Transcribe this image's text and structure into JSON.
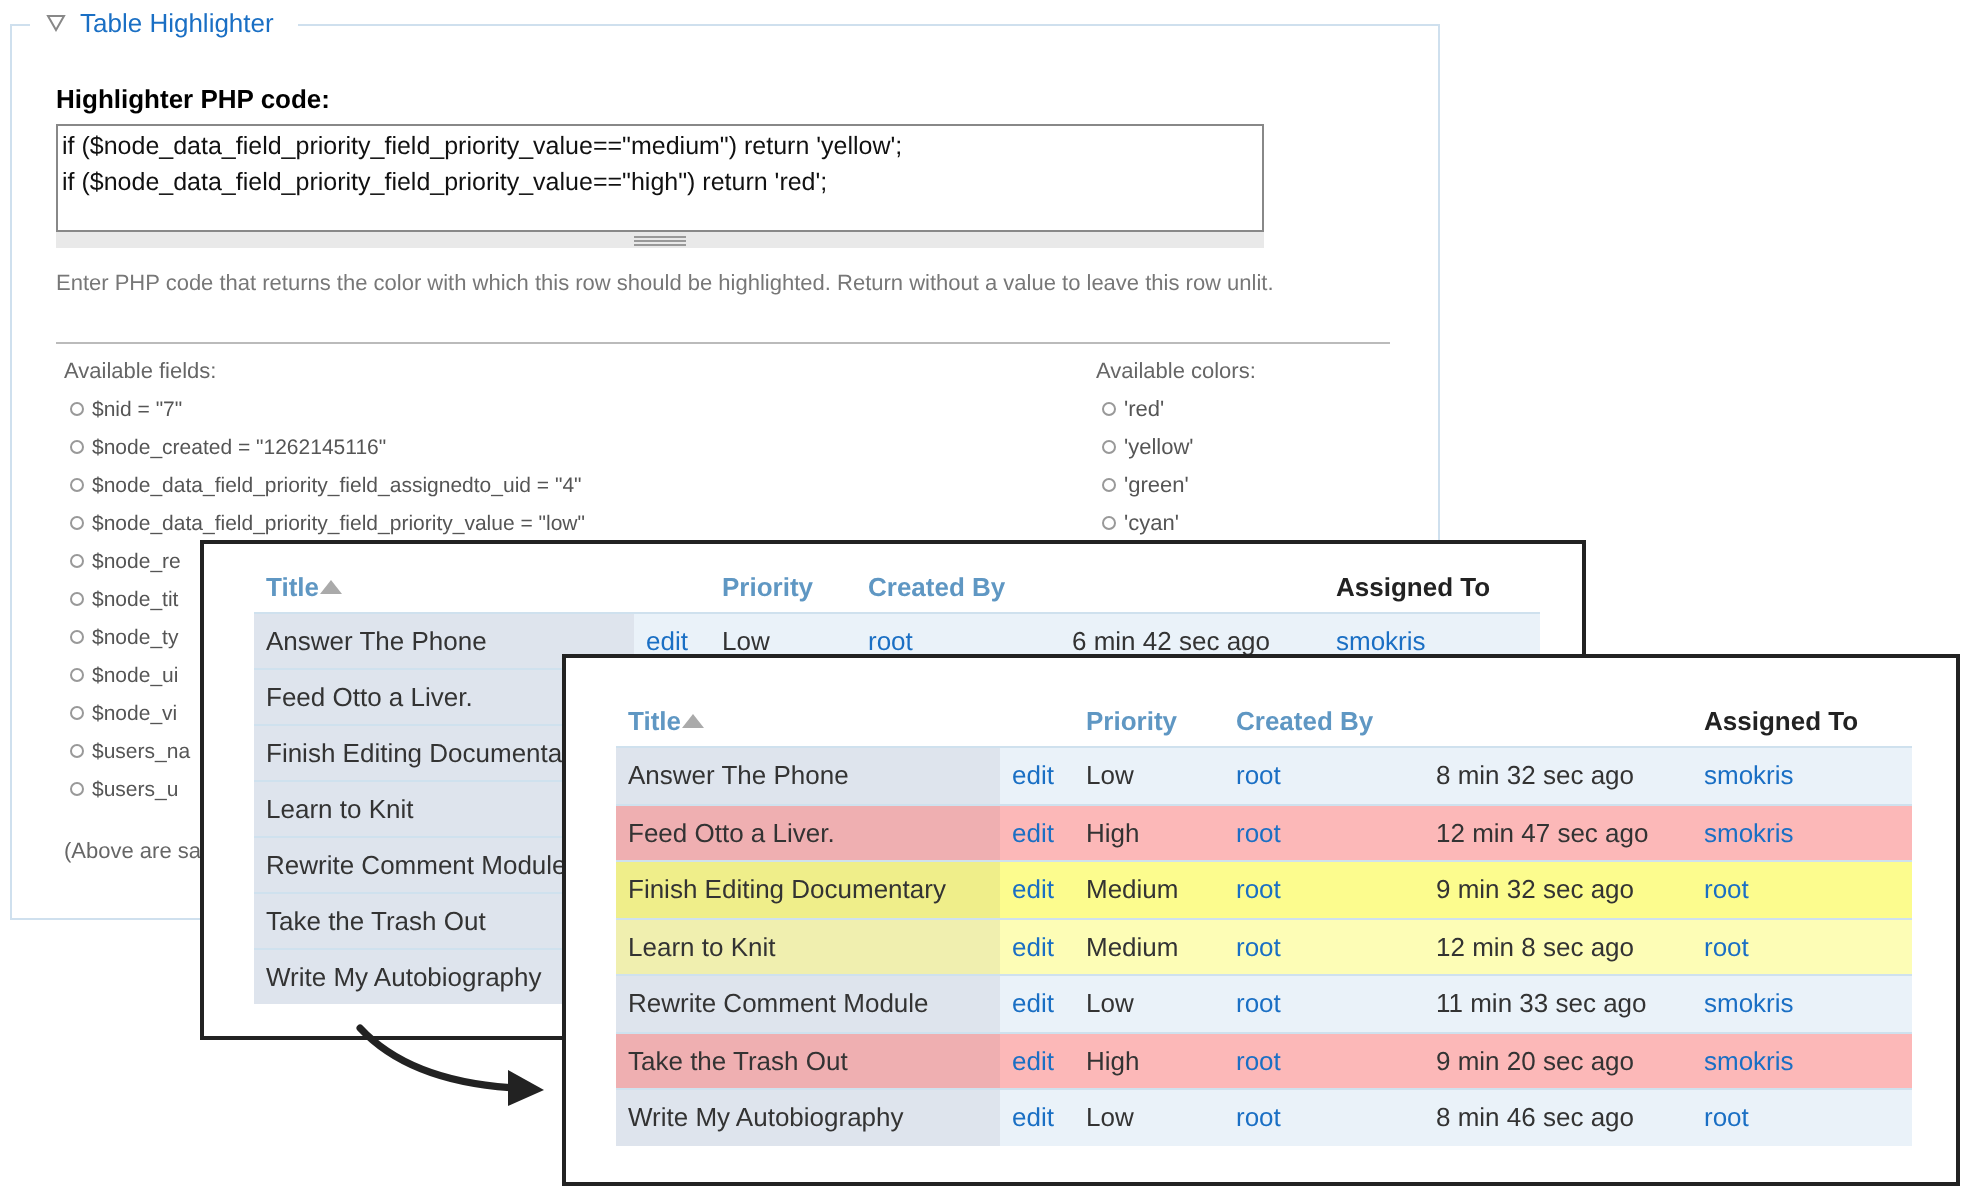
{
  "fieldset": {
    "legend": "Table Highlighter",
    "expanded": true,
    "code_label": "Highlighter PHP code:",
    "code_lines": [
      "if ($node_data_field_priority_field_priority_value==\"medium\") return 'yellow';",
      "if ($node_data_field_priority_field_priority_value==\"high\") return 'red';"
    ],
    "description": "Enter PHP code that returns the color with which this row should be highlighted. Return without a value to leave this row unlit.",
    "fields_label": "Available fields:",
    "fields": [
      "$nid = \"7\"",
      "$node_created = \"1262145116\"",
      "$node_data_field_priority_field_assignedto_uid = \"4\"",
      "$node_data_field_priority_field_priority_value = \"low\"",
      "$node_re",
      "$node_tit",
      "$node_ty",
      "$node_ui",
      "$node_vi",
      "$users_na",
      "$users_u"
    ],
    "colors_label": "Available colors:",
    "colors": [
      "'red'",
      "'yellow'",
      "'green'",
      "'cyan'"
    ],
    "footnote": "(Above are sa"
  },
  "screenshots": [
    {
      "columns": [
        {
          "label": "Title",
          "kind": "link",
          "sorted": true
        },
        {
          "label": "Priority",
          "kind": "link",
          "sorted": false
        },
        {
          "label": "Created By",
          "kind": "link",
          "sorted": false
        },
        {
          "label": "Assigned To",
          "kind": "plain",
          "sorted": false
        }
      ],
      "rows": [
        {
          "title": "Answer The Phone",
          "edit": "edit",
          "priority": "Low",
          "created_by": "root",
          "created": "6 min 42 sec ago",
          "assigned_to": "smokris"
        },
        {
          "title": "Feed Otto a Liver."
        },
        {
          "title": "Finish Editing Documenta"
        },
        {
          "title": "Learn to Knit"
        },
        {
          "title": "Rewrite Comment Module"
        },
        {
          "title": "Take the Trash Out"
        },
        {
          "title": "Write My Autobiography"
        }
      ]
    },
    {
      "columns": [
        {
          "label": "Title",
          "kind": "link",
          "sorted": true
        },
        {
          "label": "Priority",
          "kind": "link",
          "sorted": false
        },
        {
          "label": "Created By",
          "kind": "link",
          "sorted": false
        },
        {
          "label": "Assigned To",
          "kind": "plain",
          "sorted": false
        }
      ],
      "rows": [
        {
          "title": "Answer The Phone",
          "edit": "edit",
          "priority": "Low",
          "created_by": "root",
          "created": "8 min 32 sec ago",
          "assigned_to": "smokris"
        },
        {
          "title": "Feed Otto a Liver.",
          "edit": "edit",
          "priority": "High",
          "created_by": "root",
          "created": "12 min 47 sec ago",
          "assigned_to": "smokris",
          "color": "#fcb8b8"
        },
        {
          "title": "Finish Editing Documentary",
          "edit": "edit",
          "priority": "Medium",
          "created_by": "root",
          "created": "9 min 32 sec ago",
          "assigned_to": "root",
          "color": "#fcfc8e"
        },
        {
          "title": "Learn to Knit",
          "edit": "edit",
          "priority": "Medium",
          "created_by": "root",
          "created": "12 min 8 sec ago",
          "assigned_to": "root",
          "color": "#fdfdb6"
        },
        {
          "title": "Rewrite Comment Module",
          "edit": "edit",
          "priority": "Low",
          "created_by": "root",
          "created": "11 min 33 sec ago",
          "assigned_to": "smokris"
        },
        {
          "title": "Take the Trash Out",
          "edit": "edit",
          "priority": "High",
          "created_by": "root",
          "created": "9 min 20 sec ago",
          "assigned_to": "smokris",
          "color": "#fcb8b8"
        },
        {
          "title": "Write My Autobiography",
          "edit": "edit",
          "priority": "Low",
          "created_by": "root",
          "created": "8 min 46 sec ago",
          "assigned_to": "root"
        }
      ]
    }
  ]
}
